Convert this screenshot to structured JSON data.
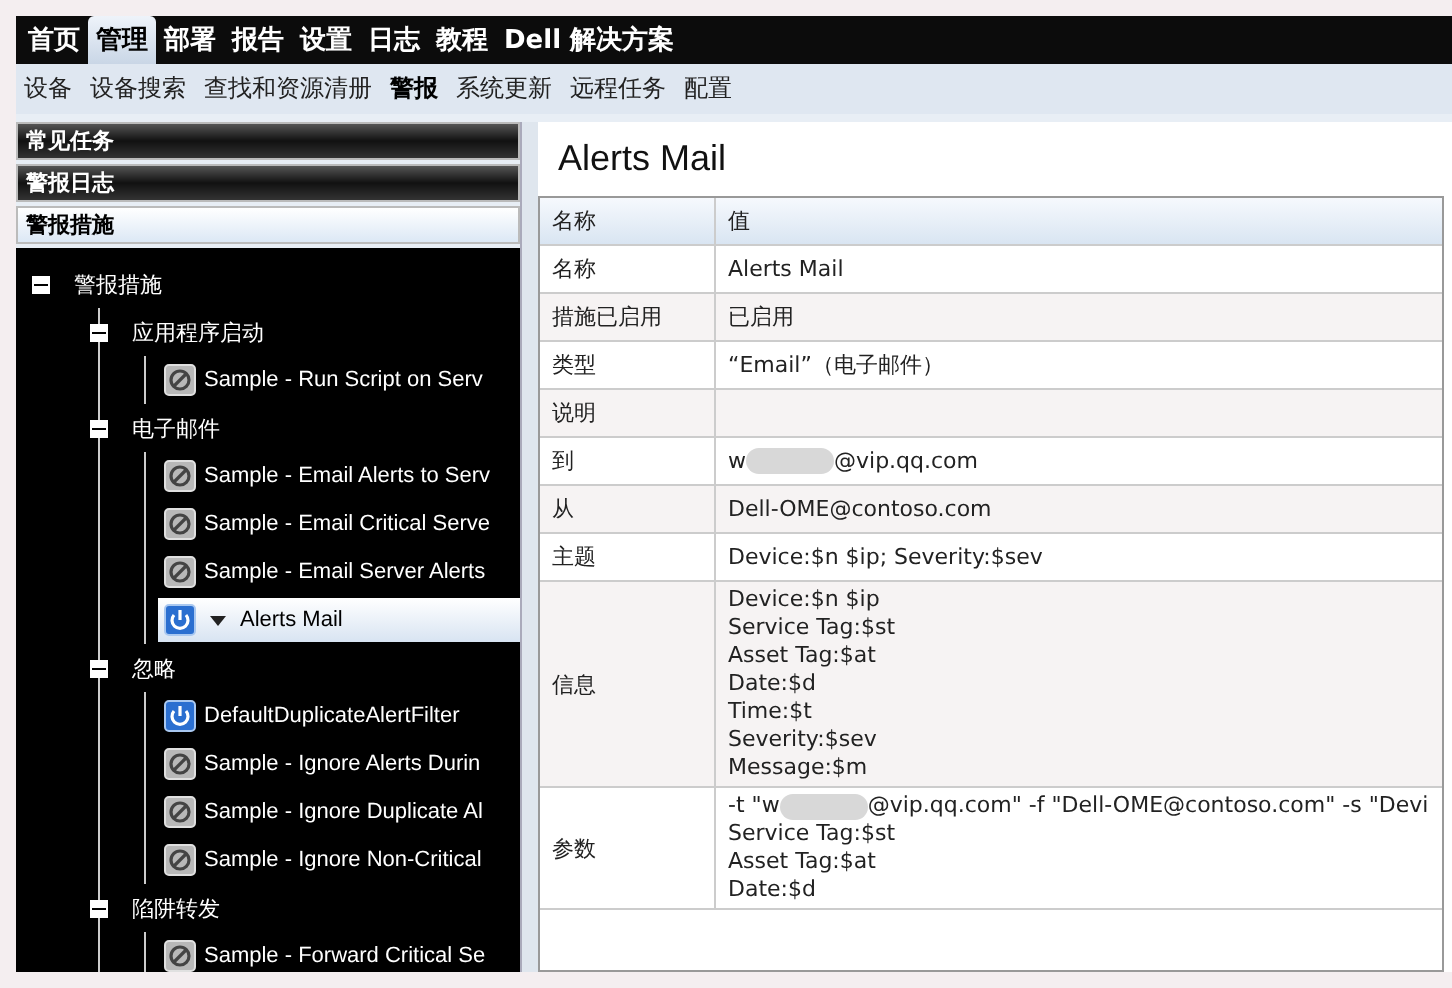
{
  "top_nav": [
    {
      "label": "首页",
      "selected": false
    },
    {
      "label": "管理",
      "selected": true
    },
    {
      "label": "部署",
      "selected": false
    },
    {
      "label": "报告",
      "selected": false
    },
    {
      "label": "设置",
      "selected": false
    },
    {
      "label": "日志",
      "selected": false
    },
    {
      "label": "教程",
      "selected": false
    },
    {
      "label": "Dell 解决方案",
      "selected": false
    }
  ],
  "sub_nav": [
    {
      "label": "设备",
      "selected": false
    },
    {
      "label": "设备搜索",
      "selected": false
    },
    {
      "label": "查找和资源清册",
      "selected": false
    },
    {
      "label": "警报",
      "selected": true
    },
    {
      "label": "系统更新",
      "selected": false
    },
    {
      "label": "远程任务",
      "selected": false
    },
    {
      "label": "配置",
      "selected": false
    }
  ],
  "sidebar": {
    "sections": [
      {
        "label": "常见任务",
        "selected": false
      },
      {
        "label": "警报日志",
        "selected": false
      },
      {
        "label": "警报措施",
        "selected": true
      }
    ],
    "tree": {
      "label": "警报措施",
      "expanded": true,
      "children": [
        {
          "label": "应用程序启动",
          "expanded": true,
          "children": [
            {
              "label": "Sample - Run Script on Serv",
              "enabled": false,
              "selected": false
            }
          ]
        },
        {
          "label": "电子邮件",
          "expanded": true,
          "children": [
            {
              "label": "Sample - Email Alerts to Serv",
              "enabled": false,
              "selected": false
            },
            {
              "label": "Sample - Email Critical Serve",
              "enabled": false,
              "selected": false
            },
            {
              "label": "Sample - Email Server Alerts",
              "enabled": false,
              "selected": false
            },
            {
              "label": "Alerts Mail",
              "enabled": true,
              "selected": true
            }
          ]
        },
        {
          "label": "忽略",
          "expanded": true,
          "children": [
            {
              "label": "DefaultDuplicateAlertFilter",
              "enabled": true,
              "selected": false
            },
            {
              "label": "Sample - Ignore Alerts Durin",
              "enabled": false,
              "selected": false
            },
            {
              "label": "Sample - Ignore Duplicate Al",
              "enabled": false,
              "selected": false
            },
            {
              "label": "Sample - Ignore Non-Critical",
              "enabled": false,
              "selected": false
            }
          ]
        },
        {
          "label": "陷阱转发",
          "expanded": true,
          "children": [
            {
              "label": "Sample - Forward Critical Se",
              "enabled": false,
              "selected": false
            }
          ]
        }
      ]
    }
  },
  "details": {
    "title": "Alerts Mail",
    "columns": [
      "名称",
      "值"
    ],
    "rows": [
      {
        "name": "名称",
        "lines": [
          [
            "Alerts Mail"
          ]
        ]
      },
      {
        "name": "措施已启用",
        "lines": [
          [
            "已启用"
          ]
        ]
      },
      {
        "name": "类型",
        "lines": [
          [
            "“Email”（电子邮件）"
          ]
        ]
      },
      {
        "name": "说明"
      },
      {
        "name": "到",
        "lines": [
          [
            "w",
            "@vip.qq.com"
          ]
        ]
      },
      {
        "name": "从",
        "lines": [
          [
            "Dell-OME@contoso.com"
          ]
        ]
      },
      {
        "name": "主题",
        "lines": [
          [
            "Device:$n $ip; Severity:$sev"
          ]
        ]
      },
      {
        "name": "信息",
        "lines": [
          [
            "Device:$n $ip"
          ],
          [
            "Service Tag:$st"
          ],
          [
            "Asset Tag:$at"
          ],
          [
            "Date:$d"
          ],
          [
            "Time:$t"
          ],
          [
            "Severity:$sev"
          ],
          [
            "Message:$m"
          ]
        ]
      },
      {
        "name": "参数",
        "lines": [
          [
            "-t \"w",
            "@vip.qq.com\" -f \"Dell-OME@contoso.com\" -s \"Devi"
          ],
          [
            "Service Tag:$st"
          ],
          [
            "Asset Tag:$at"
          ],
          [
            "Date:$d"
          ]
        ]
      }
    ]
  }
}
